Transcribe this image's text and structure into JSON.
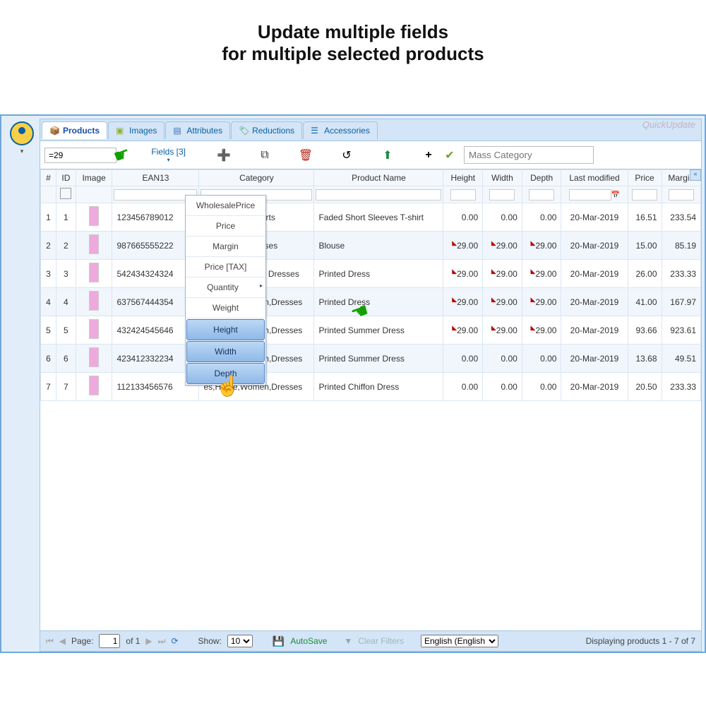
{
  "hero_line1": "Update multiple fields",
  "hero_line2": "for multiple selected products",
  "brand": "QuickUpdate",
  "tabs": {
    "products": "Products",
    "images": "Images",
    "attributes": "Attributes",
    "reductions": "Reductions",
    "accessories": "Accessories"
  },
  "toolbar": {
    "value": "=29",
    "fields_label": "Fields [3]",
    "mass_cat_placeholder": "Mass Category"
  },
  "fields_menu": [
    "WholesalePrice",
    "Price",
    "Margin",
    "Price [TAX]",
    "Quantity",
    "Weight",
    "Height",
    "Width",
    "Depth"
  ],
  "fields_selected": [
    "Height",
    "Width",
    "Depth"
  ],
  "columns": {
    "row": "#",
    "id": "ID",
    "image": "Image",
    "ean13": "EAN13",
    "category": "Category",
    "product_name": "Product Name",
    "height": "Height",
    "width": "Width",
    "depth": "Depth",
    "last_modified": "Last modified",
    "price": "Price",
    "margin": "Margin"
  },
  "rows": [
    {
      "n": "1",
      "id": "1",
      "ean": "123456789012",
      "cat": "omen,Tops,T-shirts",
      "name": "Faded Short Sleeves T-shirt",
      "h": "0.00",
      "w": "0.00",
      "d": "0.00",
      "lm": "20-Mar-2019",
      "price": "16.51",
      "margin": "233.54"
    },
    {
      "n": "2",
      "id": "2",
      "ean": "987665555222",
      "cat": "omen,Tops,Blouses",
      "name": "Blouse",
      "h": "29.00",
      "w": "29.00",
      "d": "29.00",
      "lm": "20-Mar-2019",
      "price": "15.00",
      "margin": "85.19"
    },
    {
      "n": "3",
      "id": "3",
      "ean": "542434324324",
      "cat": ",Dresses,Casual Dresses",
      "name": "Printed Dress",
      "h": "29.00",
      "w": "29.00",
      "d": "29.00",
      "lm": "20-Mar-2019",
      "price": "26.00",
      "margin": "233.33"
    },
    {
      "n": "4",
      "id": "4",
      "ean": "637567444354",
      "cat": "es,Home,Women,Dresses",
      "name": "Printed Dress",
      "h": "29.00",
      "w": "29.00",
      "d": "29.00",
      "lm": "20-Mar-2019",
      "price": "41.00",
      "margin": "167.97"
    },
    {
      "n": "5",
      "id": "5",
      "ean": "432424545646",
      "cat": "es,Home,Women,Dresses",
      "name": "Printed Summer Dress",
      "h": "29.00",
      "w": "29.00",
      "d": "29.00",
      "lm": "20-Mar-2019",
      "price": "93.66",
      "margin": "923.61"
    },
    {
      "n": "6",
      "id": "6",
      "ean": "423412332234",
      "cat": "es,Home,Women,Dresses",
      "name": "Printed Summer Dress",
      "h": "0.00",
      "w": "0.00",
      "d": "0.00",
      "lm": "20-Mar-2019",
      "price": "13.68",
      "margin": "49.51"
    },
    {
      "n": "7",
      "id": "7",
      "ean": "112133456576",
      "cat": "es,Home,Women,Dresses",
      "name": "Printed Chiffon Dress",
      "h": "0.00",
      "w": "0.00",
      "d": "0.00",
      "lm": "20-Mar-2019",
      "price": "20.50",
      "margin": "233.33"
    }
  ],
  "paginator": {
    "page_label": "Page:",
    "page_value": "1",
    "page_of": "of 1",
    "show_label": "Show:",
    "show_value": "10",
    "autosave": "AutoSave",
    "clear_filters": "Clear Filters",
    "lang": "English (English",
    "status": "Displaying products 1 - 7 of 7"
  }
}
